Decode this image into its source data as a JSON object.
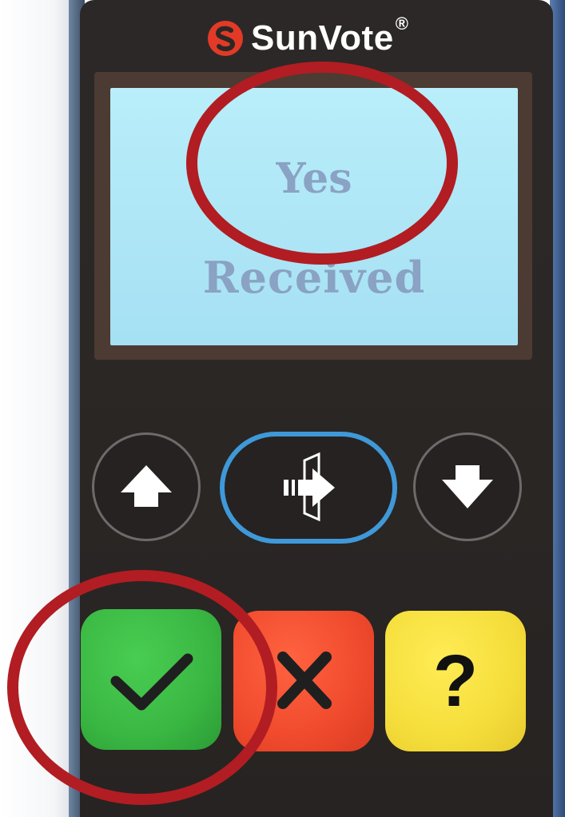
{
  "brand": {
    "name": "SunVote",
    "registered_mark": "®",
    "logo_icon": "sunvote-logo-icon",
    "logo_color": "#e23a27"
  },
  "display": {
    "line1": "Yes",
    "line2": "Received",
    "background_color": "#b2eaf7",
    "text_color": "#8aa2c3"
  },
  "navigation": {
    "up_icon": "arrow-up-icon",
    "enter_icon": "enter-door-icon",
    "down_icon": "arrow-down-icon",
    "enter_ring_color": "#3f99d8"
  },
  "keys": {
    "yes": {
      "icon": "checkmark-icon",
      "color": "#3ab743"
    },
    "no": {
      "icon": "x-mark-icon",
      "color": "#f04a2d"
    },
    "abstain": {
      "label": "?",
      "icon": "question-mark-icon",
      "color": "#f5de3b"
    }
  },
  "annotations": {
    "highlight_color": "#b11d22",
    "highlighted": [
      "display-yes-text",
      "yes-key"
    ]
  }
}
